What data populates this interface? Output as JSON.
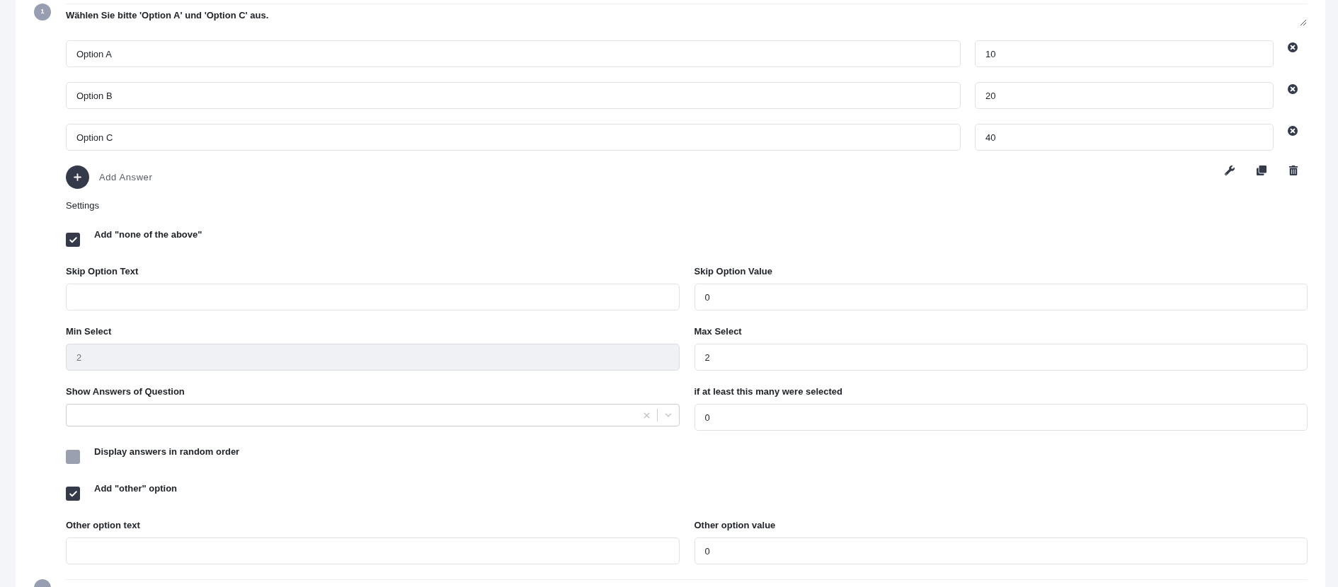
{
  "question": {
    "number": "1",
    "text": "Wählen Sie bitte 'Option A' und 'Option C' aus."
  },
  "answers": [
    {
      "text": "Option A",
      "value": "10"
    },
    {
      "text": "Option B",
      "value": "20"
    },
    {
      "text": "Option C",
      "value": "40"
    }
  ],
  "add_answer": {
    "label": "Add Answer"
  },
  "settings": {
    "title": "Settings",
    "rows": [
      {
        "kind": "checkbox",
        "label": "Add \"none of the above\"",
        "checked": true
      },
      {
        "kind": "fields",
        "fields": [
          {
            "kind": "input",
            "label": "Skip Option Text",
            "disabled": false
          },
          {
            "kind": "input",
            "label": "Skip Option Value",
            "value": "0",
            "disabled": false
          }
        ]
      },
      {
        "kind": "fields",
        "fields": [
          {
            "kind": "input",
            "label": "Min Select",
            "value": "2",
            "disabled": true
          },
          {
            "kind": "input",
            "label": "Max Select",
            "value": "2",
            "disabled": false
          }
        ]
      },
      {
        "kind": "fields",
        "fields": [
          {
            "kind": "select",
            "label": "Show Answers of Question",
            "disabled": false
          },
          {
            "kind": "input",
            "label": "if at least this many were selected",
            "value": "0",
            "disabled": false
          }
        ]
      },
      {
        "kind": "checkbox",
        "label": "Display answers in random order",
        "checked": false
      },
      {
        "kind": "checkbox",
        "label": "Add \"other\" option",
        "checked": true
      },
      {
        "kind": "fields",
        "fields": [
          {
            "kind": "input",
            "label": "Other option text",
            "disabled": false
          },
          {
            "kind": "input",
            "label": "Other option value",
            "value": "0",
            "disabled": false
          }
        ]
      }
    ]
  }
}
